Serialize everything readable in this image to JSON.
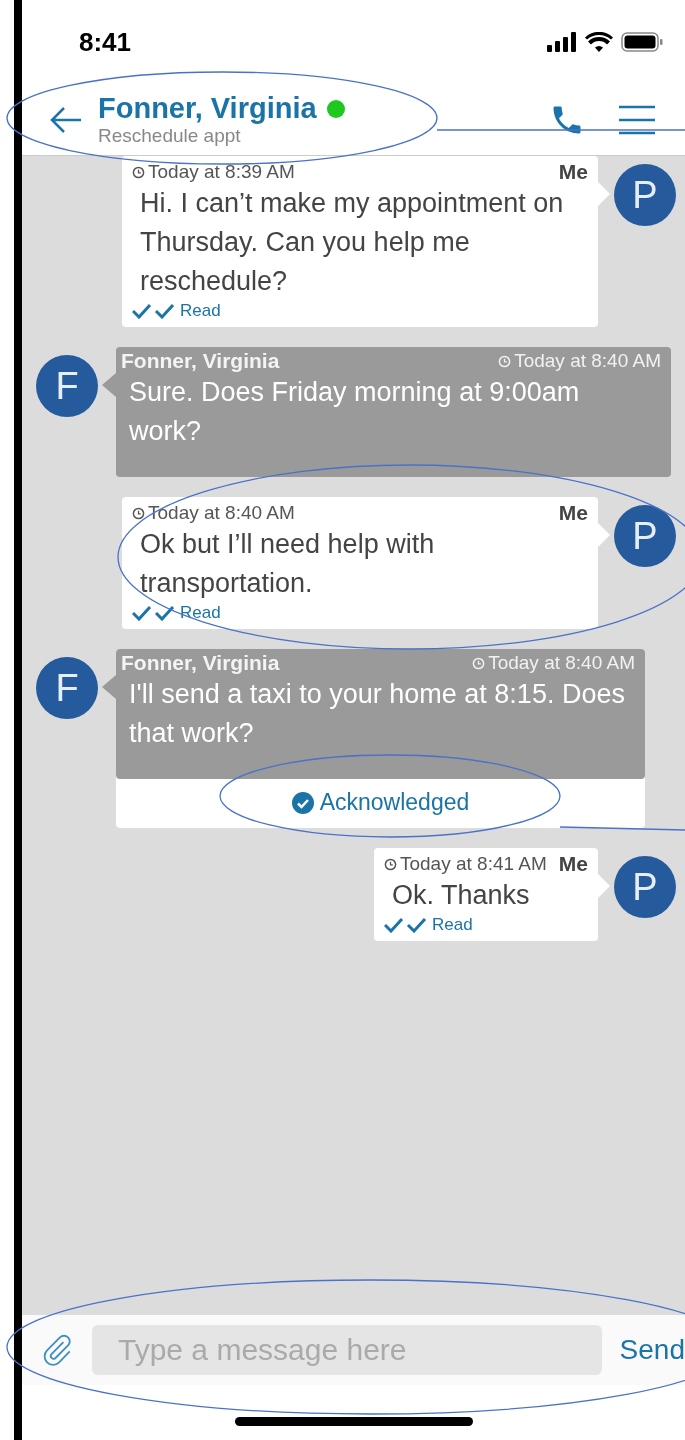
{
  "status_bar": {
    "time": "8:41"
  },
  "header": {
    "title": "Fonner, Virginia",
    "online": true,
    "subtitle": "Reschedule appt"
  },
  "messages": [
    {
      "kind": "me",
      "avatar": "P",
      "sender": "Me",
      "time": "Today at 8:39 AM",
      "text": "Hi. I can’t make my appointment on Thursday. Can you help me reschedule?",
      "receipt": "Read"
    },
    {
      "kind": "them",
      "avatar": "F",
      "sender": "Fonner, Virginia",
      "time": "Today at 8:40 AM",
      "text": "Sure. Does Friday morning at 9:00am work?"
    },
    {
      "kind": "me",
      "avatar": "P",
      "sender": "Me",
      "time": "Today at 8:40 AM",
      "text": "Ok but I’ll need help with transportation.",
      "receipt": "Read"
    },
    {
      "kind": "them",
      "avatar": "F",
      "sender": "Fonner, Virginia",
      "time": "Today at 8:40 AM",
      "text": "I'll send a taxi to your home at 8:15. Does that work?",
      "acknowledgement": "Acknowledged"
    },
    {
      "kind": "me",
      "avatar": "P",
      "sender": "Me",
      "time": "Today at 8:41 AM",
      "text": "Ok. Thanks",
      "receipt": "Read"
    }
  ],
  "composer": {
    "placeholder": "Type a message here",
    "send": "Send"
  }
}
